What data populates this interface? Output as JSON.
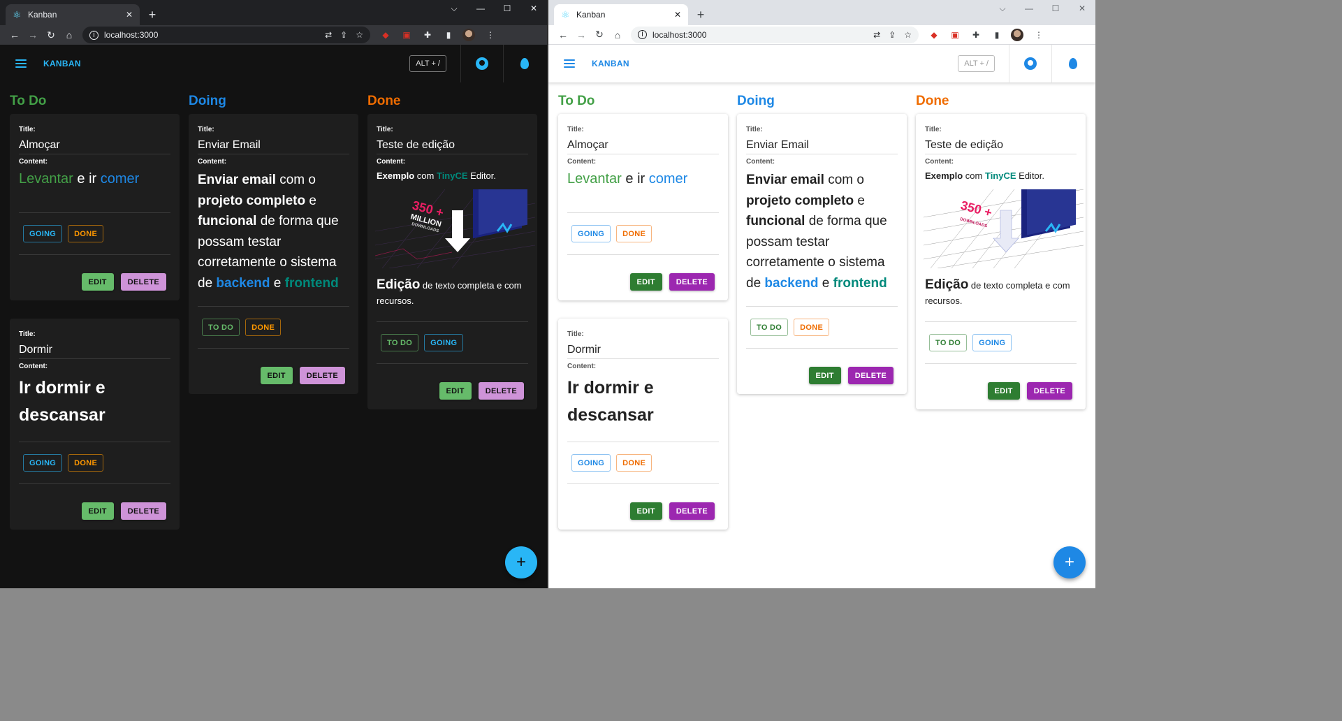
{
  "browser": {
    "tab_title": "Kanban",
    "url": "localhost:3000",
    "tab_close": "✕",
    "new_tab": "+",
    "window_controls": [
      "⌵",
      "—",
      "☐",
      "✕"
    ]
  },
  "app": {
    "brand": "KANBAN",
    "shortcut": "ALT + /",
    "fab": "+"
  },
  "labels": {
    "title": "Title:",
    "content": "Content:"
  },
  "buttons": {
    "going": "GOING",
    "done": "DONE",
    "todo": "TO DO",
    "edit": "EDIT",
    "delete": "DELETE"
  },
  "columns": {
    "todo": {
      "name": "To Do",
      "color": "#43a047"
    },
    "doing": {
      "name": "Doing",
      "color": "#1e88e5"
    },
    "done": {
      "name": "Done",
      "color": "#ef6c00"
    }
  },
  "cards": {
    "almocar": {
      "title": "Almoçar",
      "w1": "Levantar",
      "w2": " e ir ",
      "w3": "comer"
    },
    "dormir": {
      "title": "Dormir",
      "w1": "Ir dormir e descansar"
    },
    "email": {
      "title": "Enviar Email",
      "s1": "Enviar email",
      "s2": " com o ",
      "s3": "projeto completo",
      "s4": " e ",
      "s5": "funcional",
      "s6": " de forma que possam testar corretamente o sistema de ",
      "s7": "backend",
      "s8": " e ",
      "s9": "frontend"
    },
    "teste": {
      "title": "Teste de edição",
      "s1": "Exemplo",
      "s2": " com ",
      "s3": "TinyCE",
      "s4": " Editor.",
      "img_text_1": "350 +",
      "img_text_2": "MILLION",
      "img_text_3": "DOWNLOADS",
      "s5": "Edição",
      "s6": " de texto completa e com recursos."
    }
  },
  "colors": {
    "accent": "#29b6f6",
    "dark_bg": "#121212",
    "dark_card": "#1e1e1e"
  }
}
